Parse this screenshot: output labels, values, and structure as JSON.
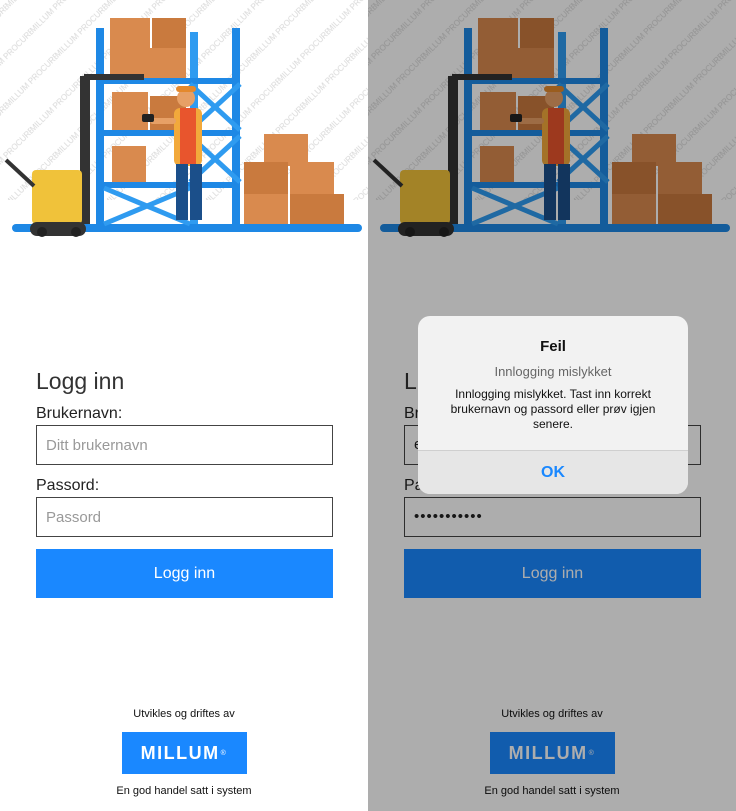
{
  "watermark": "MILLUM PROCUREMENT",
  "login": {
    "title": "Logg inn",
    "username_label": "Brukernavn:",
    "username_placeholder": "Ditt brukernavn",
    "password_label": "Passord:",
    "password_placeholder": "Passord",
    "submit_label": "Logg inn"
  },
  "login_filled": {
    "title_partial": "L",
    "username_label_partial": "Br",
    "username_value_partial": "e",
    "password_label_partial": "Pa",
    "password_mask": "•••••••••••",
    "submit_label": "Logg inn"
  },
  "footer": {
    "top": "Utvikles og driftes av",
    "brand": "MILLUM",
    "brand_mark": "®",
    "bottom": "En god handel satt i system"
  },
  "dialog": {
    "title": "Feil",
    "subtitle": "Innlogging mislykket",
    "message": "Innlogging mislykket. Tast inn korrekt brukernavn og passord eller prøv igjen senere.",
    "ok_label": "OK"
  },
  "colors": {
    "accent": "#1a88ff",
    "overlay": "rgba(0,0,0,0.32)",
    "rack": "#1e88e5",
    "box": "#d98a4e",
    "forklift": "#f0c23a"
  },
  "icons": [
    "warehouse-illustration",
    "millum-logo"
  ]
}
